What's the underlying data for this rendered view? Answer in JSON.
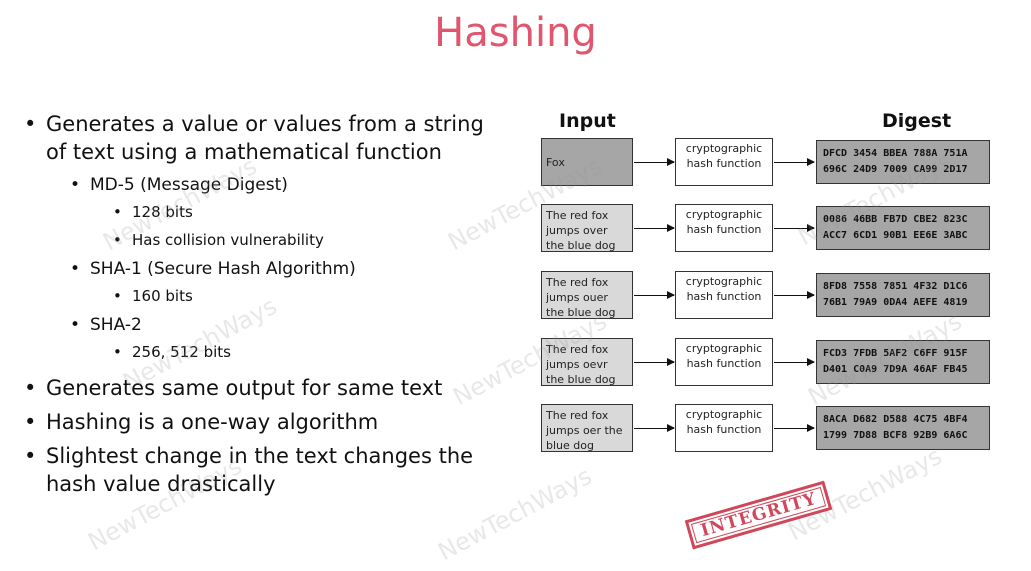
{
  "title": "Hashing",
  "bullets": {
    "b1": "Generates a value or values from a string of text using a mathematical function",
    "md5": "MD-5 (Message Digest)",
    "md5_sub": [
      "128 bits",
      "Has collision vulnerability"
    ],
    "sha1": "SHA-1 (Secure Hash Algorithm)",
    "sha1_sub": [
      "160 bits"
    ],
    "sha2": "SHA-2",
    "sha2_sub": [
      "256, 512 bits"
    ],
    "b2": "Generates same output for same text",
    "b3": "Hashing is a one-way algorithm",
    "b4": "Slightest change in the text changes the hash value drastically"
  },
  "diagram": {
    "input_header": "Input",
    "digest_header": "Digest",
    "rows": [
      {
        "input": "Fox",
        "function": "cryptographic hash function",
        "digest": "DFCD 3454 BBEA 788A 751A\n696C 24D9 7009 CA99 2D17"
      },
      {
        "input": "The red fox jumps over the blue dog",
        "function": "cryptographic hash function",
        "digest": "0086 46BB FB7D CBE2 823C\nACC7 6CD1 90B1 EE6E 3ABC"
      },
      {
        "input": "The red fox jumps ouer the blue dog",
        "function": "cryptographic hash function",
        "digest": "8FD8 7558 7851 4F32 D1C6\n76B1 79A9 0DA4 AEFE 4819"
      },
      {
        "input": "The red fox jumps oevr the blue dog",
        "function": "cryptographic hash function",
        "digest": "FCD3 7FDB 5AF2 C6FF 915F\nD401 C0A9 7D9A 46AF FB45"
      },
      {
        "input": "The red fox jumps oer the blue dog",
        "function": "cryptographic hash function",
        "digest": "8ACA D682 D588 4C75 4BF4\n1799 7D88 BCF8 92B9 6A6C"
      }
    ]
  },
  "stamp": "INTEGRITY",
  "watermark": "NewTechWays",
  "colors": {
    "title": "#e0566f",
    "stamp": "#c8283e",
    "digest_bg": "#a6a6a6"
  }
}
